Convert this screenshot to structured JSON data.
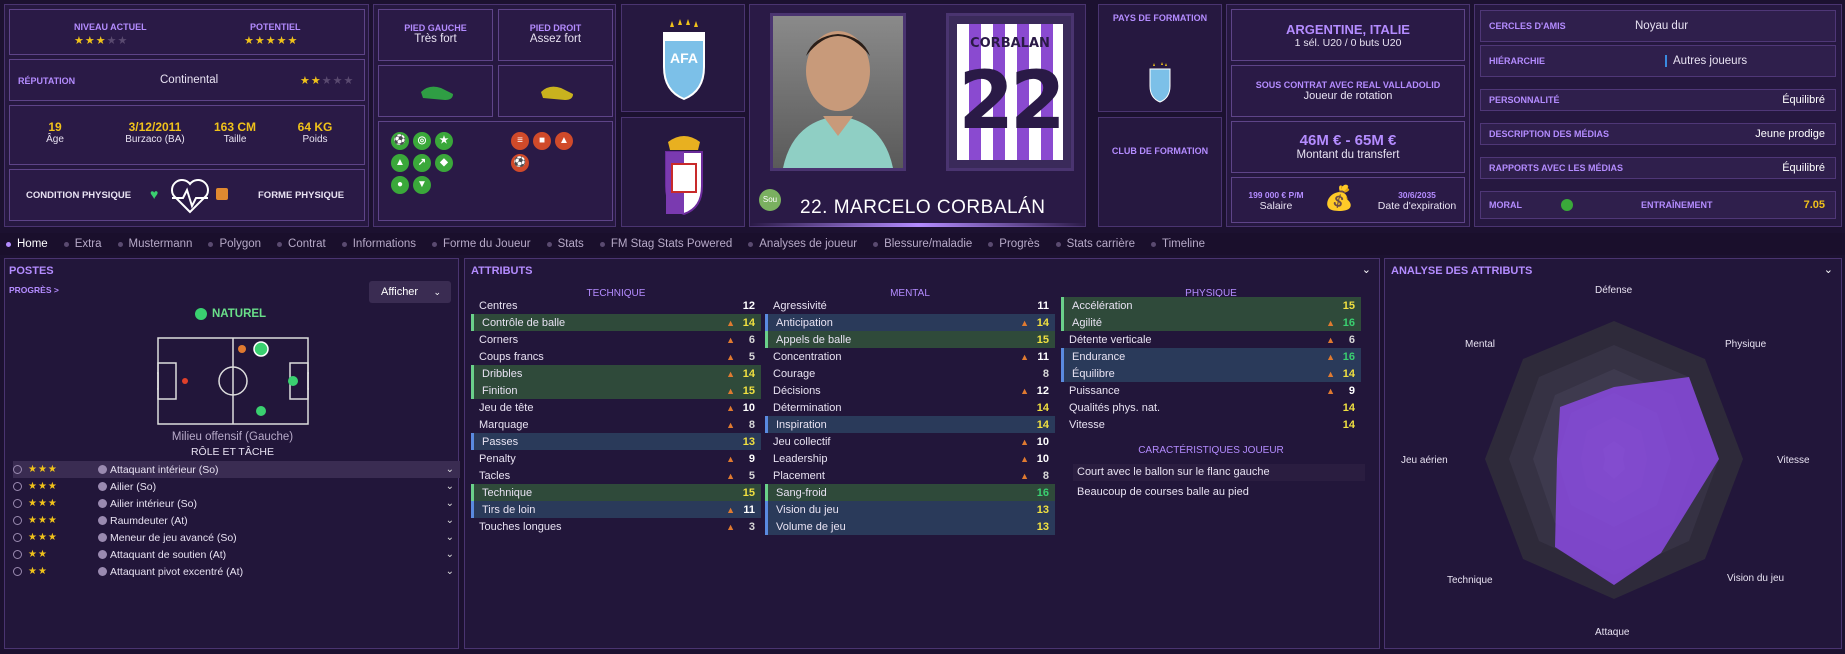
{
  "ratings": {
    "current_label": "NIVEAU ACTUEL",
    "potential_label": "POTENTIEL",
    "current_stars": "★★★",
    "current_empty": "★★",
    "potential_stars": "★★★★★",
    "potential_empty": ""
  },
  "reputation": {
    "label": "RÉPUTATION",
    "value": "Continental",
    "stars": "★★",
    "empty": "★★★"
  },
  "bio": {
    "age": "19",
    "age_label": "Âge",
    "dob": "3/12/2011",
    "birthplace": "Burzaco (BA)",
    "height": "163 CM",
    "height_label": "Taille",
    "weight": "64 KG",
    "weight_label": "Poids"
  },
  "condition": {
    "physical_label": "CONDITION PHYSIQUE",
    "form_label": "FORME PHYSIQUE"
  },
  "feet": {
    "left_label": "PIED GAUCHE",
    "left_value": "Très fort",
    "right_label": "PIED DROIT",
    "right_value": "Assez fort"
  },
  "player": {
    "kit_name": "CORBALAN",
    "kit_number": "22",
    "full_name": "22. MARCELO CORBALÁN",
    "badge": "Sou"
  },
  "formation": {
    "country_label": "PAYS DE FORMATION",
    "club_label": "CLUB DE FORMATION"
  },
  "nationality": {
    "countries": "ARGENTINE, ITALIE",
    "caps": "1 sél. U20 / 0 buts U20"
  },
  "contract": {
    "status": "SOUS CONTRAT AVEC REAL VALLADOLID",
    "role": "Joueur de rotation",
    "value": "46M € - 65M €",
    "value_label": "Montant du transfert",
    "salary": "199 000 € P/M",
    "salary_label": "Salaire",
    "expiry": "30/6/2035",
    "expiry_label": "Date d'expiration"
  },
  "personal": [
    {
      "key": "CERCLES D'AMIS",
      "value": "Noyau dur"
    },
    {
      "key": "HIÉRARCHIE",
      "value": "Autres joueurs"
    },
    {
      "key": "PERSONNALITÉ",
      "value": "Équilibré"
    },
    {
      "key": "DESCRIPTION DES MÉDIAS",
      "value": "Jeune prodige"
    },
    {
      "key": "RAPPORTS AVEC LES MÉDIAS",
      "value": "Équilibré"
    }
  ],
  "moral": {
    "label": "MORAL",
    "training_label": "ENTRAÎNEMENT",
    "training_value": "7.05"
  },
  "tabs": [
    "Home",
    "Extra",
    "Mustermann",
    "Polygon",
    "Contrat",
    "Informations",
    "Forme du Joueur",
    "Stats",
    "FM Stag Stats Powered",
    "Analyses de joueur",
    "Blessure/maladie",
    "Progrès",
    "Stats carrière",
    "Timeline"
  ],
  "positions": {
    "title": "POSTES",
    "progress": "PROGRÈS >",
    "show": "Afficher",
    "natural": "NATUREL",
    "pos_name": "Milieu offensif (Gauche)",
    "role_title": "RÔLE ET TÂCHE",
    "roles": [
      {
        "stars": "★★★",
        "name": "Attaquant intérieur (So)"
      },
      {
        "stars": "★★★",
        "name": "Ailier (So)"
      },
      {
        "stars": "★★★",
        "name": "Ailier intérieur (So)"
      },
      {
        "stars": "★★★",
        "name": "Raumdeuter (At)"
      },
      {
        "stars": "★★★",
        "name": "Meneur de jeu avancé (So)"
      },
      {
        "stars": "★★",
        "name": "Attaquant de soutien (At)"
      },
      {
        "stars": "★★",
        "name": "Attaquant pivot excentré (At)"
      }
    ]
  },
  "attributes": {
    "title": "ATTRIBUTS",
    "tech_label": "TECHNIQUE",
    "mental_label": "MENTAL",
    "phys_label": "PHYSIQUE",
    "traits_label": "CARACTÉRISTIQUES JOUEUR",
    "technique": [
      {
        "n": "Centres",
        "v": "12"
      },
      {
        "n": "Contrôle de balle",
        "v": "14"
      },
      {
        "n": "Corners",
        "v": "6"
      },
      {
        "n": "Coups francs",
        "v": "5"
      },
      {
        "n": "Dribbles",
        "v": "14"
      },
      {
        "n": "Finition",
        "v": "15"
      },
      {
        "n": "Jeu de tête",
        "v": "10"
      },
      {
        "n": "Marquage",
        "v": "8"
      },
      {
        "n": "Passes",
        "v": "13"
      },
      {
        "n": "Penalty",
        "v": "9"
      },
      {
        "n": "Tacles",
        "v": "5"
      },
      {
        "n": "Technique",
        "v": "15"
      },
      {
        "n": "Tirs de loin",
        "v": "11"
      },
      {
        "n": "Touches longues",
        "v": "3"
      }
    ],
    "mental": [
      {
        "n": "Agressivité",
        "v": "11"
      },
      {
        "n": "Anticipation",
        "v": "14"
      },
      {
        "n": "Appels de balle",
        "v": "15"
      },
      {
        "n": "Concentration",
        "v": "11"
      },
      {
        "n": "Courage",
        "v": "8"
      },
      {
        "n": "Décisions",
        "v": "12"
      },
      {
        "n": "Détermination",
        "v": "14"
      },
      {
        "n": "Inspiration",
        "v": "14"
      },
      {
        "n": "Jeu collectif",
        "v": "10"
      },
      {
        "n": "Leadership",
        "v": "10"
      },
      {
        "n": "Placement",
        "v": "8"
      },
      {
        "n": "Sang-froid",
        "v": "16"
      },
      {
        "n": "Vision du jeu",
        "v": "13"
      },
      {
        "n": "Volume de jeu",
        "v": "13"
      }
    ],
    "physique": [
      {
        "n": "Accélération",
        "v": "15"
      },
      {
        "n": "Agilité",
        "v": "16"
      },
      {
        "n": "Détente verticale",
        "v": "6"
      },
      {
        "n": "Endurance",
        "v": "16"
      },
      {
        "n": "Équilibre",
        "v": "14"
      },
      {
        "n": "Puissance",
        "v": "9"
      },
      {
        "n": "Qualités phys. nat.",
        "v": "14"
      },
      {
        "n": "Vitesse",
        "v": "14"
      }
    ],
    "traits": [
      "Court avec le ballon sur le flanc gauche",
      "Beaucoup de courses balle au pied"
    ]
  },
  "analysis": {
    "title": "ANALYSE DES ATTRIBUTS",
    "axes": [
      "Défense",
      "Physique",
      "Vitesse",
      "Vision du jeu",
      "Attaque",
      "Technique",
      "Jeu aérien",
      "Mental"
    ]
  }
}
